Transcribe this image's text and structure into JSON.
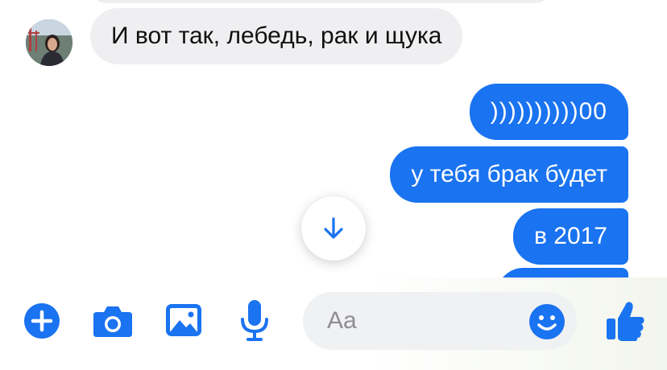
{
  "conversation": {
    "incoming": [
      {
        "text": "И вот так, лебедь, рак и щука"
      }
    ],
    "outgoing": [
      {
        "text": "))))))))))00"
      },
      {
        "text": "у тебя брак будет"
      },
      {
        "text": "в 2017"
      }
    ]
  },
  "composer": {
    "placeholder": "Aa"
  },
  "icons": {
    "add": "plus-circle-icon",
    "camera": "camera-icon",
    "gallery": "photo-icon",
    "voice": "microphone-icon",
    "emoji": "smiley-icon",
    "like": "thumbs-up-icon",
    "scroll": "arrow-down-icon"
  },
  "colors": {
    "accent": "#1a73f0",
    "incoming_bubble": "#efeff1",
    "input_background": "#f0f1f3"
  }
}
